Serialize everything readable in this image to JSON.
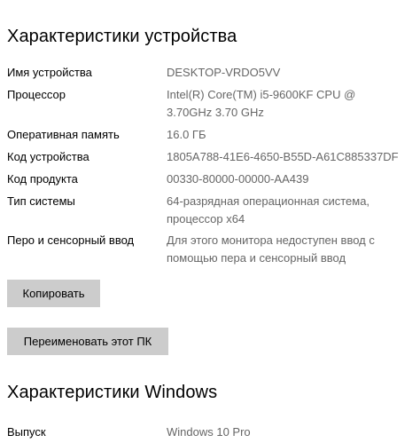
{
  "device_specs": {
    "title": "Характеристики устройства",
    "rows": [
      {
        "label": "Имя устройства",
        "value": "DESKTOP-VRDO5VV"
      },
      {
        "label": "Процессор",
        "value": "Intel(R) Core(TM) i5-9600KF CPU @\n3.70GHz   3.70 GHz"
      },
      {
        "label": "Оперативная память",
        "value": "16.0 ГБ"
      },
      {
        "label": "Код устройства",
        "value": "1805A788-41E6-4650-B55D-A61C885337DF"
      },
      {
        "label": "Код продукта",
        "value": "00330-80000-00000-AA439"
      },
      {
        "label": "Тип системы",
        "value": "64-разрядная операционная система,\nпроцессор x64"
      },
      {
        "label": "Перо и сенсорный ввод",
        "value": "Для этого монитора недоступен ввод с\nпомощью пера и сенсорный ввод"
      }
    ],
    "copy_button": "Копировать",
    "rename_button": "Переименовать этот ПК"
  },
  "windows_specs": {
    "title": "Характеристики Windows",
    "rows": [
      {
        "label": "Выпуск",
        "value": "Windows 10 Pro"
      }
    ]
  }
}
